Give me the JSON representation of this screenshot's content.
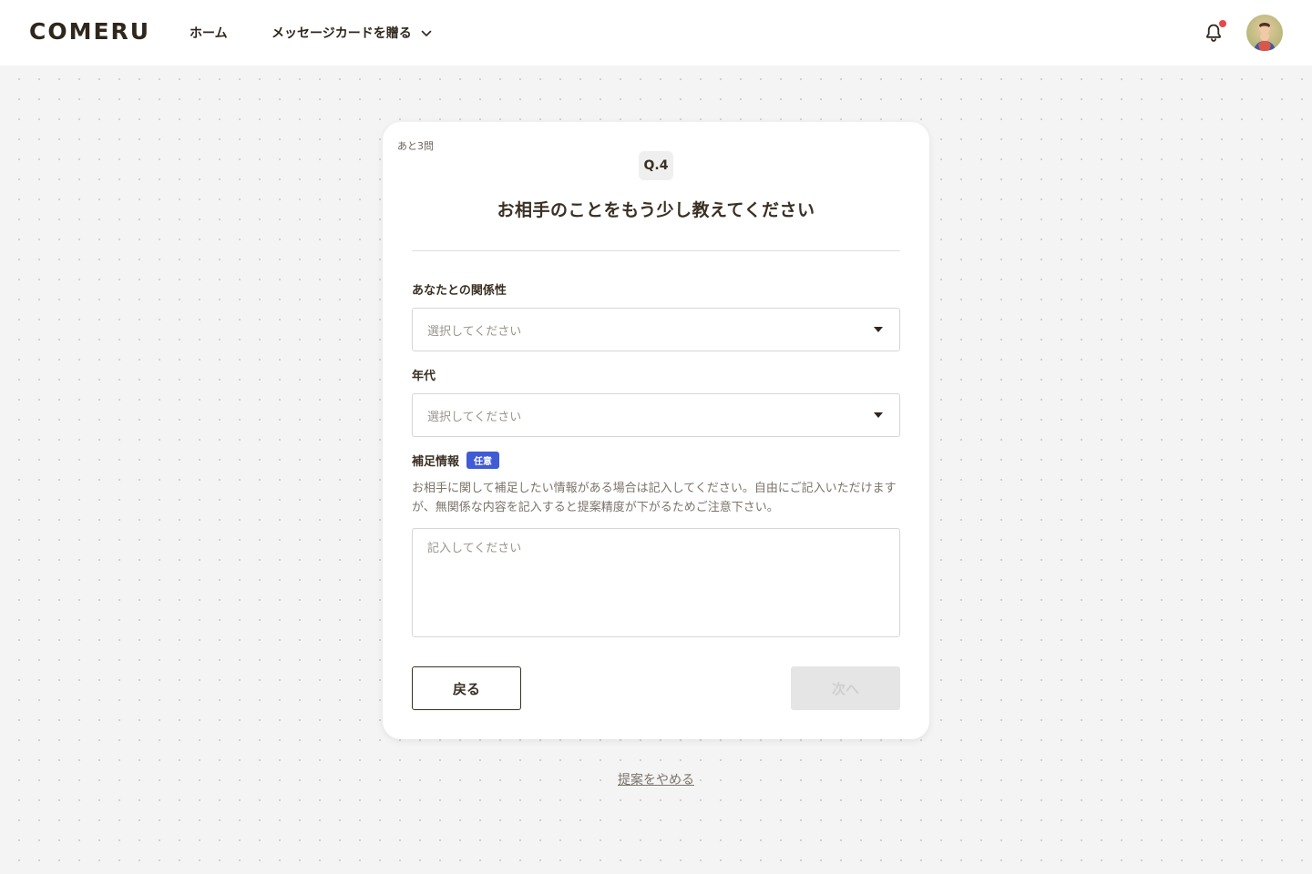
{
  "header": {
    "logo": "COMERU",
    "nav": {
      "home": "ホーム",
      "send_card": "メッセージカードを贈る"
    }
  },
  "card": {
    "remaining": "あと3問",
    "question_number": "Q.4",
    "question_title": "お相手のことをもう少し教えてください",
    "fields": {
      "relationship": {
        "label": "あなたとの関係性",
        "placeholder": "選択してください"
      },
      "age": {
        "label": "年代",
        "placeholder": "選択してください"
      },
      "notes": {
        "label": "補足情報",
        "badge": "任意",
        "help": "お相手に関して補足したい情報がある場合は記入してください。自由にご記入いただけますが、無関係な内容を記入すると提案精度が下がるためご注意下さい。",
        "placeholder": "記入してください"
      }
    },
    "buttons": {
      "back": "戻る",
      "next": "次へ"
    }
  },
  "footer": {
    "cancel": "提案をやめる"
  },
  "colors": {
    "text": "#3a3024",
    "badge": "#3f5bd6",
    "notification_dot": "#e5484d",
    "disabled_button": "#e5e5e5"
  },
  "icons": {
    "nav_dropdown": "chevron-down-icon",
    "notifications": "bell-icon",
    "select_arrow": "caret-down-icon"
  }
}
